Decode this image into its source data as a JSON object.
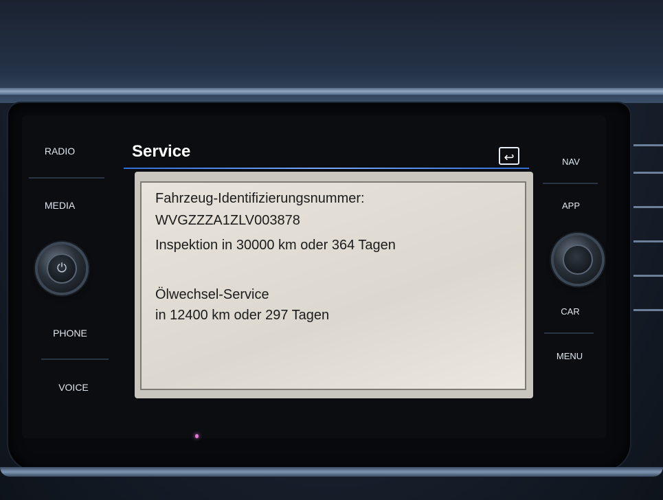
{
  "screen": {
    "title": "Service",
    "back_icon": "back-arrow-icon"
  },
  "left_buttons": [
    "RADIO",
    "MEDIA",
    "PHONE",
    "VOICE"
  ],
  "right_buttons": [
    "NAV",
    "APP",
    "CAR",
    "MENU"
  ],
  "service_info": {
    "vin_label": "Fahrzeug-Identifizierungsnummer:",
    "vin_value": "WVGZZZA1ZLV003878",
    "inspection": "Inspektion in 30000 km oder 364 Tagen",
    "oil_title": "Ölwechsel-Service",
    "oil_detail": "in 12400 km oder 297 Tagen"
  },
  "colors": {
    "accent_line": "#2f6fd8",
    "panel_background": "#e8e4dc",
    "text": "#1b1b1b"
  }
}
